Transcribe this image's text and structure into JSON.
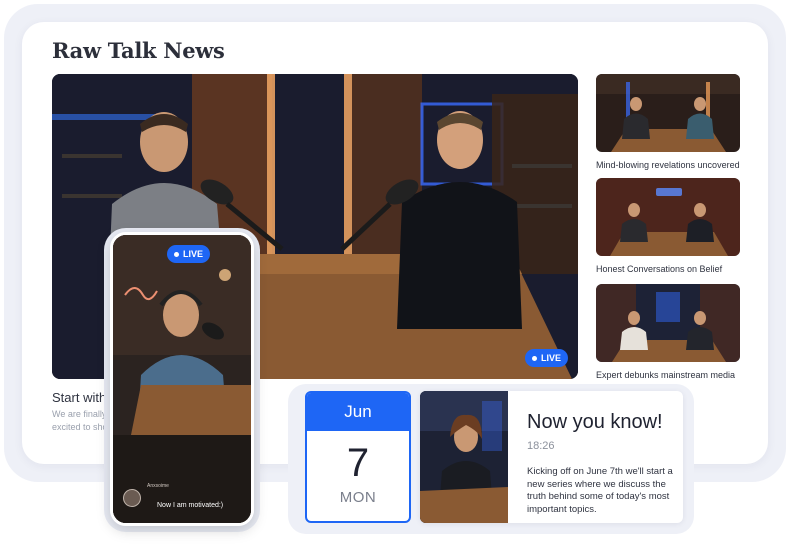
{
  "brand": {
    "name": "Raw Talk News"
  },
  "hero": {
    "live_label": "LIVE",
    "title": "Start with",
    "description_lines": [
      "We are finally i",
      "excited to sho"
    ]
  },
  "side_list": [
    {
      "caption": "Mind-blowing revelations uncovered"
    },
    {
      "caption": "Honest Conversations on Belief"
    },
    {
      "caption": "Expert debunks mainstream media"
    }
  ],
  "phone": {
    "live_label": "LIVE",
    "user_name": "Anxsoime",
    "message": "Now I am motivated:)"
  },
  "date": {
    "month": "Jun",
    "day": "7",
    "weekday": "MON"
  },
  "info": {
    "title": "Now you know!",
    "time": "18:26",
    "body": "Kicking off on June 7th we'll start a new series where we discuss the truth behind some of today's most important topics."
  },
  "colors": {
    "accent": "#1e66f5",
    "frame": "#eef0f7",
    "text": "#2f3340",
    "muted": "#9aa0ad"
  }
}
